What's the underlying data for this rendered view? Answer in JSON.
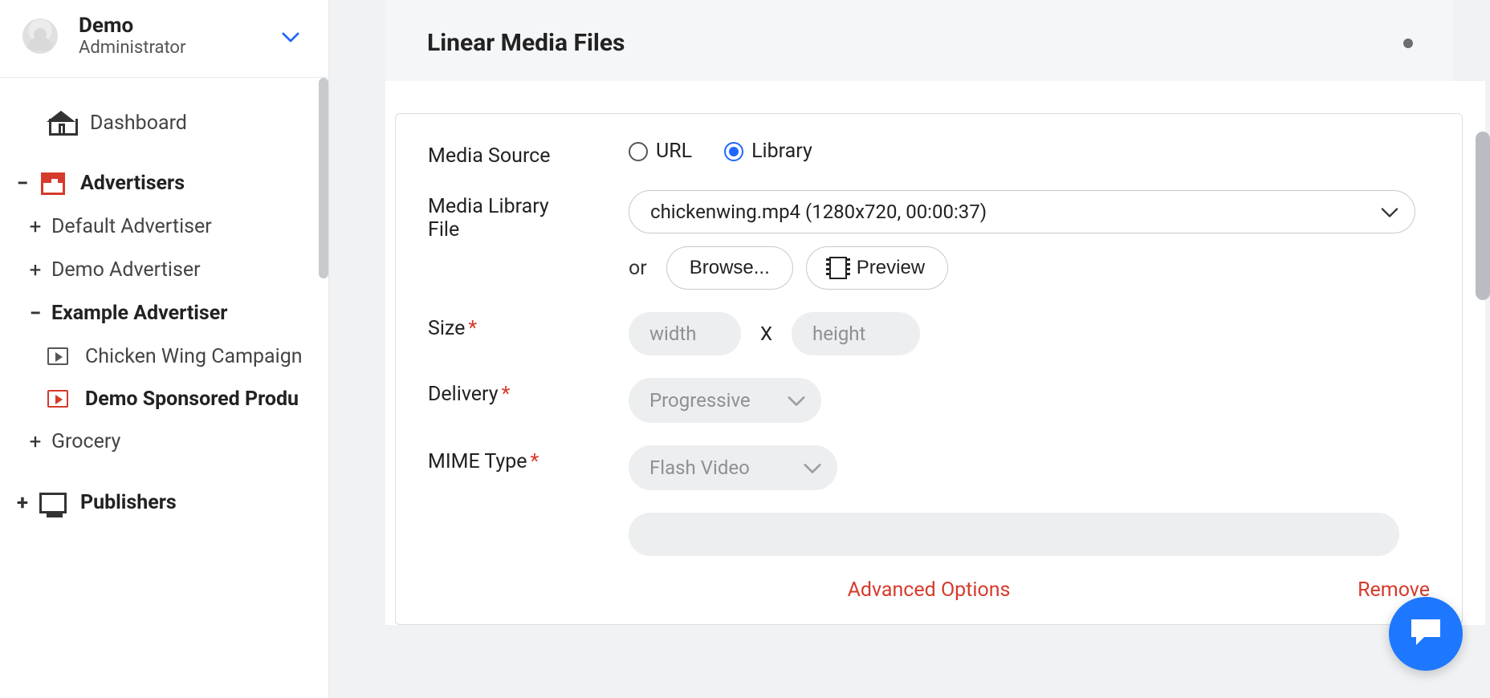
{
  "user": {
    "name": "Demo",
    "role": "Administrator"
  },
  "nav": {
    "dashboard": "Dashboard",
    "advertisers": "Advertisers",
    "publishers": "Publishers",
    "items": {
      "default_adv": "Default Advertiser",
      "demo_adv": "Demo Advertiser",
      "example_adv": "Example Advertiser",
      "chicken_wing": "Chicken Wing Campaign",
      "demo_sponsored": "Demo Sponsored Produ",
      "grocery": "Grocery"
    }
  },
  "panel": {
    "title": "Linear Media Files"
  },
  "form": {
    "media_source_label": "Media Source",
    "radio_url": "URL",
    "radio_library": "Library",
    "media_library_label": "Media Library",
    "media_library_sub": "File",
    "file_select_value": "chickenwing.mp4 (1280x720, 00:00:37)",
    "or_text": "or",
    "browse_label": "Browse...",
    "preview_label": "Preview",
    "size_label": "Size",
    "width_ph": "width",
    "height_ph": "height",
    "x_text": "X",
    "delivery_label": "Delivery",
    "delivery_value": "Progressive",
    "mime_label": "MIME Type",
    "mime_value": "Flash Video",
    "advanced_options": "Advanced Options",
    "remove": "Remove"
  }
}
